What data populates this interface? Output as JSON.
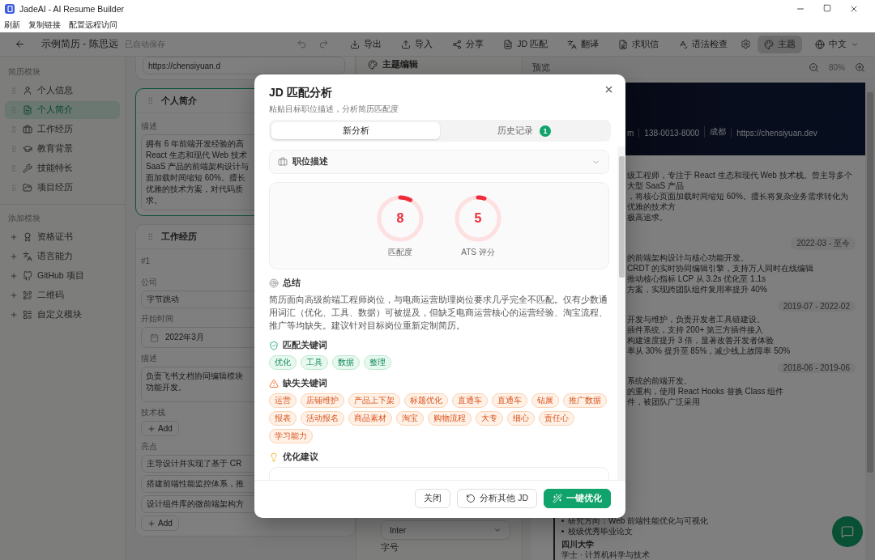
{
  "window": {
    "title": "JadeAI - AI Resume Builder"
  },
  "menu": [
    "刷新",
    "复制链接",
    "配置远程访问"
  ],
  "header": {
    "document_title": "示例简历 - 陈思远",
    "save_status": "已自动保存",
    "actions": [
      {
        "label": "导出"
      },
      {
        "label": "导入"
      },
      {
        "label": "分享"
      },
      {
        "label": "JD 匹配"
      },
      {
        "label": "翻译"
      },
      {
        "label": "求职信"
      },
      {
        "label": "语法检查"
      }
    ],
    "theme_button": {
      "label": "主题",
      "selected": true
    },
    "language": "中文"
  },
  "sidebar": {
    "sections": [
      {
        "title": "简历模块",
        "kind": "module",
        "items": [
          {
            "label": "个人信息",
            "selected": false
          },
          {
            "label": "个人简介",
            "selected": true
          },
          {
            "label": "工作经历",
            "selected": false
          },
          {
            "label": "教育背景",
            "selected": false
          },
          {
            "label": "技能特长",
            "selected": false
          },
          {
            "label": "项目经历",
            "selected": false
          }
        ]
      },
      {
        "title": "添加模块",
        "kind": "add",
        "items": [
          {
            "label": "资格证书",
            "selected": false
          },
          {
            "label": "语言能力",
            "selected": false
          },
          {
            "label": "GitHub 项目",
            "selected": false
          },
          {
            "label": "二维码",
            "selected": false
          },
          {
            "label": "自定义模块",
            "selected": false
          }
        ]
      }
    ]
  },
  "editor": {
    "website_value": "https://chensiyuan.d",
    "summary_card": {
      "title": "个人简介",
      "selected": true,
      "field_label": "描述",
      "lines": [
        "拥有 6 年前端开发经验的高",
        "React 生态和现代 Web 技术",
        "SaaS 产品的前端架构设计与",
        "面加载时间缩短 60%。擅长",
        "优雅的技术方案，对代码质",
        "求。"
      ]
    },
    "work_card": {
      "title": "工作经历",
      "entry_index": "#1",
      "company_label": "公司",
      "company_value": "字节跳动",
      "start_label": "开始时间",
      "start_value": "2022年3月",
      "description_label": "描述",
      "description_lines": [
        "负责飞书文档协同编辑模块",
        "功能开发。"
      ],
      "tech_label": "技术栈",
      "tech_add": "Add",
      "highlights_label": "亮点",
      "highlights": [
        "主导设计并实现了基于 CR",
        "搭建前端性能监控体系，推",
        "设计组件库的微前端架构方"
      ],
      "highlights_add": "Add"
    }
  },
  "theme": {
    "title": "主题编辑",
    "font_value": "Inter",
    "size_label": "字号"
  },
  "preview": {
    "title": "预览",
    "zoom": "80%",
    "contact": [
      "m",
      "138-0013-8000",
      "成都",
      "https://chensiyuan.dev"
    ],
    "summary_lines": [
      "级工程师，专注于 React 生态和现代 Web 技术栈。曾主导多个大型 SaaS 产品",
      "，将核心页面加载时间缩短 60%。擅长将复杂业务需求转化为优雅的技术方",
      "极高追求。"
    ],
    "experience": [
      {
        "date": "2022-03 - 至今",
        "lines": [
          "的前端架构设计与核心功能开发。",
          "CRDT 的实时协同编辑引擎，支持万人同时在线编辑",
          "推动核心指标 LCP 从 3.2s 优化至 1.1s",
          "方案，实现跨团队组件复用率提升 40%"
        ]
      },
      {
        "date": "2019-07 - 2022-02",
        "lines": [
          "开发与维护，负责开发者工具链建设。",
          "插件系统，支持 200+ 第三方插件接入",
          "构建速度提升 3 倍，显著改善开发者体验",
          "率从 30% 提升至 85%，减少线上故障率 50%"
        ]
      },
      {
        "date": "2018-06 - 2019-06",
        "lines": [
          "系统的前端开发。",
          "的重构，使用 React Hooks 替换 Class 组件",
          "件，被团队广泛采用"
        ]
      }
    ],
    "education": {
      "bullets": [
        "研究方向：Web 前端性能优化与可视化",
        "校级优秀毕业论文"
      ],
      "school": "四川大学",
      "degree": "学士 · 计算机科学与技术"
    }
  },
  "modal": {
    "title": "JD 匹配分析",
    "subtitle": "粘贴目标职位描述，分析简历匹配度",
    "tabs": [
      {
        "label": "新分析",
        "selected": true
      },
      {
        "label": "历史记录",
        "selected": false,
        "badge": "1"
      }
    ],
    "job_description": {
      "label": "职位描述",
      "expanded": false
    },
    "scores": [
      {
        "value": "8",
        "label": "匹配度",
        "level": 0.08
      },
      {
        "value": "5",
        "label": "ATS 评分",
        "level": 0.05
      }
    ],
    "summary": {
      "title": "总结",
      "text": "简历面向高级前端工程师岗位，与电商运营助理岗位要求几乎完全不匹配。仅有少数通用词汇（优化、工具、数据）可被提及，但缺乏电商运营核心的运营经验、淘宝流程、推广等均缺失。建议针对目标岗位重新定制简历。"
    },
    "matched": {
      "title": "匹配关键词",
      "keywords": [
        "优化",
        "工具",
        "数据",
        "整理"
      ]
    },
    "missing": {
      "title": "缺失关键词",
      "keywords": [
        "运营",
        "店铺维护",
        "产品上下架",
        "标题优化",
        "直通车",
        "直通车",
        "钻展",
        "推广数据",
        "报表",
        "活动报名",
        "商品素材",
        "淘宝",
        "购物流程",
        "大专",
        "细心",
        "责任心",
        "学习能力"
      ]
    },
    "suggestions": {
      "title": "优化建议"
    },
    "buttons": [
      {
        "label": "关闭",
        "kind": "secondary"
      },
      {
        "label": "分析其他 JD",
        "kind": "refresh"
      },
      {
        "label": "一键优化",
        "kind": "primary"
      }
    ]
  }
}
